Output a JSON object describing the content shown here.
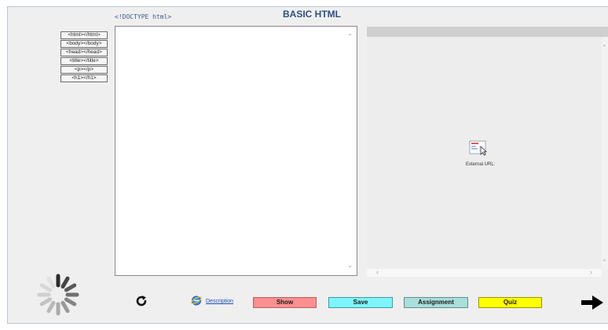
{
  "header": {
    "title": "BASIC HTML",
    "doctype_label": "<!DOCTYPE html>"
  },
  "tag_buttons": [
    {
      "label": "<html></html>"
    },
    {
      "label": "<body></body>"
    },
    {
      "label": "<head></head>"
    },
    {
      "label": "<title></title>"
    },
    {
      "label": "<p></p>"
    },
    {
      "label": "<h1></h1>"
    }
  ],
  "editor": {
    "value": ""
  },
  "preview": {
    "external_label": "External URL:"
  },
  "footer": {
    "description_link": "Description",
    "buttons": {
      "show": "Show",
      "save": "Save",
      "assignment": "Assignment",
      "quiz": "Quiz"
    }
  },
  "icons": {
    "spinner": "loading-spinner-icon",
    "reload": "reload-icon",
    "description": "internet-explorer-icon",
    "next": "arrow-right-icon",
    "external": "external-url-icon"
  },
  "colors": {
    "title": "#2e4f86",
    "show": "#fc8f8f",
    "save": "#7ef5fb",
    "assignment": "#a9dedb",
    "quiz": "#ffff00"
  }
}
